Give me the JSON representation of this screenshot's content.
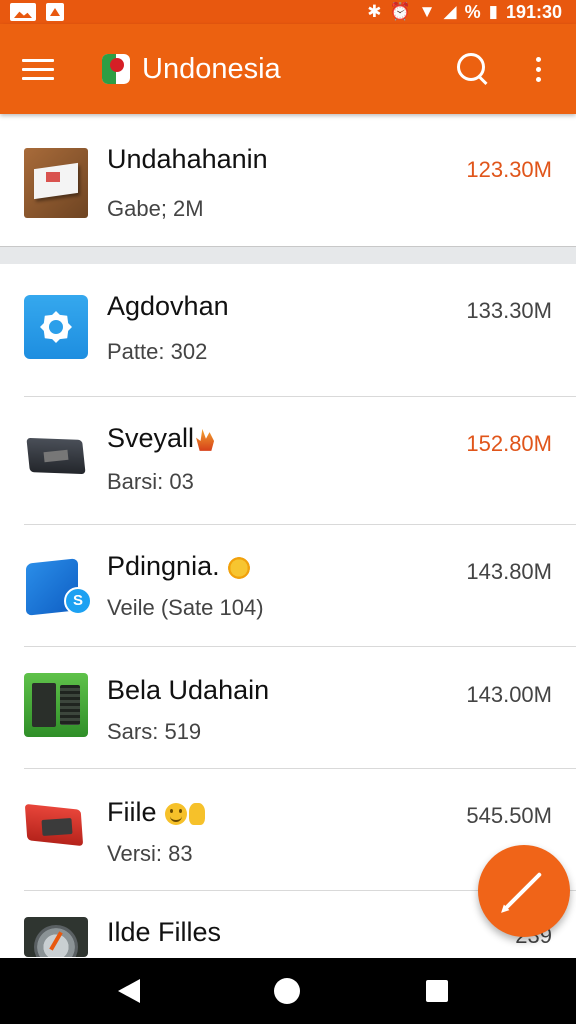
{
  "status_bar": {
    "time": "191:30",
    "percent": "%",
    "icons": [
      "image-notification-icon",
      "alert-notification-icon",
      "bluetooth-icon",
      "alarm-icon",
      "wifi-icon",
      "signal-icon",
      "battery-icon"
    ]
  },
  "app_bar": {
    "title": "Undonesia",
    "color": "#ec6110",
    "icons": [
      "menu-icon",
      "app-logo",
      "search-icon",
      "more-vert-icon"
    ]
  },
  "items": [
    {
      "name": "Undahahanin",
      "sub": "Gabe; 2M",
      "size": "123.30M",
      "size_highlight": true,
      "icon": "package-box-icon"
    },
    {
      "name": "Agdovhan",
      "sub": "Patte: 302",
      "size": "133.30M",
      "size_highlight": false,
      "icon": "gear-app-icon"
    },
    {
      "name": "Sveyall",
      "sub": "Barsi: 03",
      "size": "152.80M",
      "size_highlight": true,
      "icon": "device-icon",
      "badge": "fire-emoji"
    },
    {
      "name": "Pdingnia.",
      "sub": "Veile (Sate 104)",
      "size": "143.80M",
      "size_highlight": false,
      "icon": "skype-box-icon",
      "badge": "sun-emoji"
    },
    {
      "name": "Bela Udahain",
      "sub": "Sars: 519",
      "size": "143.00M",
      "size_highlight": false,
      "icon": "green-machine-icon"
    },
    {
      "name": "Fiile",
      "sub": "Versi: 83",
      "size": "545.50M",
      "size_highlight": false,
      "icon": "red-device-icon",
      "badge": "smile-hand-emoji"
    },
    {
      "name": "Ilde Filles",
      "sub": "",
      "size": "239",
      "size_highlight": false,
      "icon": "compass-icon"
    }
  ],
  "fab": {
    "icon": "edit-pencil-icon",
    "color": "#f06418"
  },
  "colors": {
    "accent": "#ec6110",
    "highlight_size": "#e0551a"
  }
}
